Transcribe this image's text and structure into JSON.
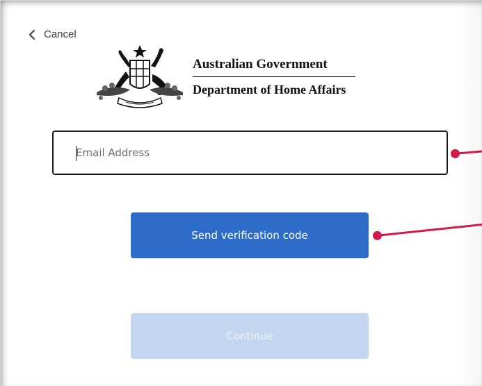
{
  "header": {
    "cancel_label": "Cancel",
    "gov_line1": "Australian Government",
    "gov_line2": "Department of Home Affairs"
  },
  "form": {
    "email_placeholder": "Email Address",
    "email_value": "",
    "send_label": "Send verification code",
    "continue_label": "Continue"
  },
  "colors": {
    "primary_button": "#2d6cc9",
    "disabled_button": "#c3d5ef",
    "pointer_annotation": "#d11a4b"
  }
}
